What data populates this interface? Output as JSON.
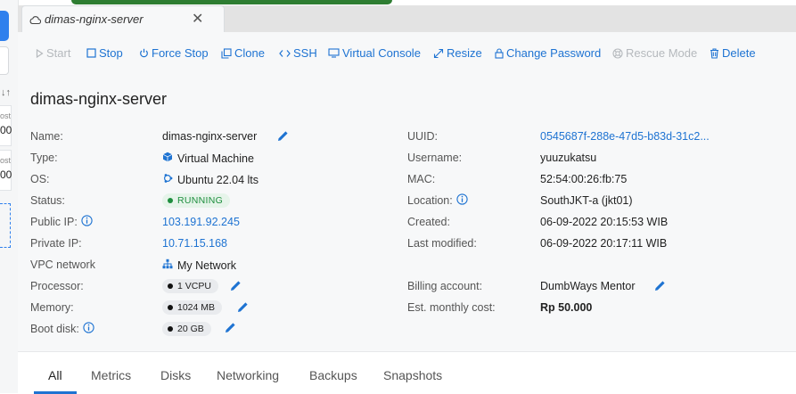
{
  "tab": {
    "title": "dimas-nginx-server",
    "close": "✕"
  },
  "left_strip": {
    "sort_icon": "↓↑",
    "card1": {
      "t1": "ost",
      "t2": "00"
    },
    "card2": {
      "t1": "ost",
      "t2": "00"
    }
  },
  "toolbar": {
    "start": "Start",
    "stop": "Stop",
    "force_stop": "Force Stop",
    "clone": "Clone",
    "ssh": "SSH",
    "virtual_console": "Virtual Console",
    "resize": "Resize",
    "change_password": "Change Password",
    "rescue_mode": "Rescue Mode",
    "delete": "Delete"
  },
  "page_title": "dimas-nginx-server",
  "details_left": {
    "name_label": "Name:",
    "name_value": "dimas-nginx-server",
    "type_label": "Type:",
    "type_value": "Virtual Machine",
    "os_label": "OS:",
    "os_value": "Ubuntu 22.04 lts",
    "status_label": "Status:",
    "status_value": "RUNNING",
    "public_ip_label": "Public IP:",
    "public_ip_value": "103.191.92.245",
    "private_ip_label": "Private IP:",
    "private_ip_value": "10.71.15.168",
    "vpc_label": "VPC network",
    "vpc_value": "My Network",
    "processor_label": "Processor:",
    "processor_value": "1 VCPU",
    "memory_label": "Memory:",
    "memory_value": "1024 MB",
    "boot_disk_label": "Boot disk:",
    "boot_disk_value": "20 GB"
  },
  "details_right": {
    "uuid_label": "UUID:",
    "uuid_value": "0545687f-288e-47d5-b83d-31c2...",
    "username_label": "Username:",
    "username_value": "yuuzukatsu",
    "mac_label": "MAC:",
    "mac_value": "52:54:00:26:fb:75",
    "location_label": "Location:",
    "location_value": "SouthJKT-a (jkt01)",
    "created_label": "Created:",
    "created_value": "06-09-2022 20:15:53 WIB",
    "modified_label": "Last modified:",
    "modified_value": "06-09-2022 20:17:11 WIB",
    "billing_label": "Billing account:",
    "billing_value": "DumbWays Mentor",
    "cost_label": "Est. monthly cost:",
    "cost_value": "Rp 50.000"
  },
  "bottom_tabs": [
    "All",
    "Metrics",
    "Disks",
    "Networking",
    "Backups",
    "Snapshots"
  ],
  "colors": {
    "accent": "#1e73d2",
    "running": "#1e8e3e",
    "disabled": "#b5b9bd"
  }
}
